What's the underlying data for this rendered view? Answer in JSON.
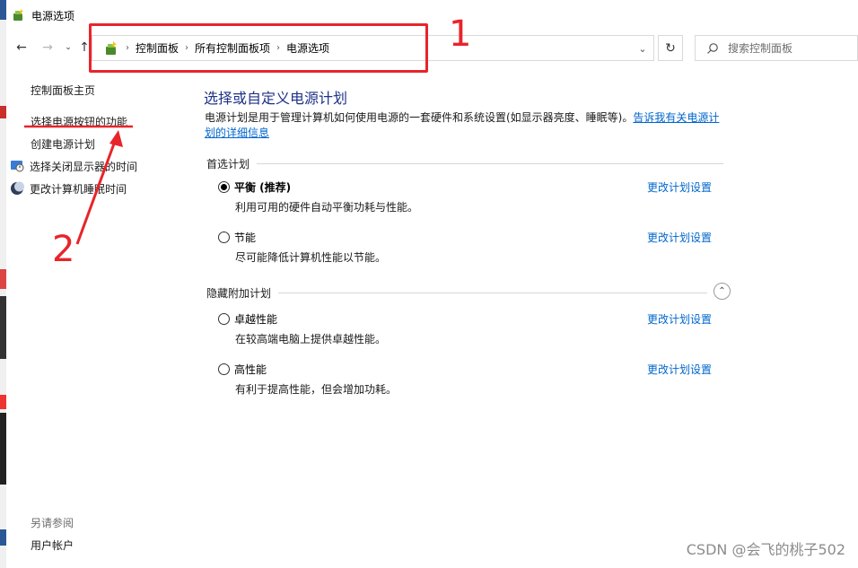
{
  "window": {
    "title": "电源选项"
  },
  "nav": {
    "breadcrumbs": [
      "控制面板",
      "所有控制面板项",
      "电源选项"
    ],
    "search_placeholder": "搜索控制面板"
  },
  "sidebar": {
    "items": [
      {
        "label": "控制面板主页"
      },
      {
        "label": "选择电源按钮的功能"
      },
      {
        "label": "创建电源计划"
      },
      {
        "label": "选择关闭显示器的时间"
      },
      {
        "label": "更改计算机睡眠时间"
      }
    ],
    "see_also_title": "另请参阅",
    "see_also_items": [
      {
        "label": "用户帐户"
      }
    ]
  },
  "main": {
    "title": "选择或自定义电源计划",
    "description": "电源计划是用于管理计算机如何使用电源的一套硬件和系统设置(如显示器亮度、睡眠等)。",
    "description_link": "告诉我有关电源计划的详细信息",
    "preferred_header": "首选计划",
    "hidden_header": "隐藏附加计划",
    "change_link": "更改计划设置",
    "preferred_plans": [
      {
        "name": "平衡 (推荐)",
        "desc": "利用可用的硬件自动平衡功耗与性能。",
        "selected": true
      },
      {
        "name": "节能",
        "desc": "尽可能降低计算机性能以节能。",
        "selected": false
      }
    ],
    "hidden_plans": [
      {
        "name": "卓越性能",
        "desc": "在较高端电脑上提供卓越性能。",
        "selected": false
      },
      {
        "name": "高性能",
        "desc": "有利于提高性能，但会增加功耗。",
        "selected": false
      }
    ]
  },
  "annotations": {
    "label_1": "1",
    "label_2": "2",
    "color": "#e8242b"
  },
  "watermark": "CSDN @会飞的桃子502",
  "colors": {
    "title_blue": "#1e3287",
    "link_blue": "#0066cc"
  }
}
